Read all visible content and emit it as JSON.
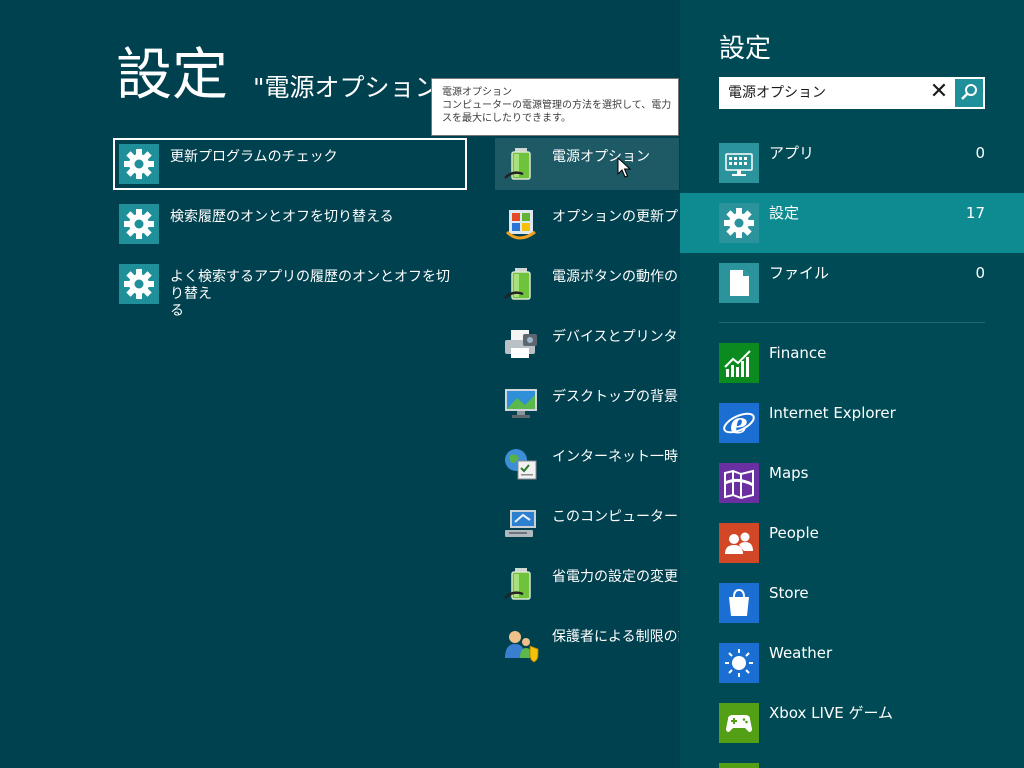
{
  "main": {
    "title": "設定",
    "query": "\"電源オプション\"",
    "left_results": [
      {
        "label": "更新プログラムのチェック",
        "icon": "gear-icon"
      },
      {
        "label": "検索履歴のオンとオフを切り替える",
        "icon": "gear-icon"
      },
      {
        "label": "よく検索するアプリの履歴のオンとオフを切り替え\nる",
        "icon": "gear-icon"
      }
    ],
    "right_results": [
      {
        "label": "電源オプション",
        "icon": "battery-icon"
      },
      {
        "label": "オプションの更新プログ",
        "icon": "windows-update-icon"
      },
      {
        "label": "電源ボタンの動作の変",
        "icon": "battery-icon"
      },
      {
        "label": "デバイスとプリンターの表",
        "icon": "printer-icon"
      },
      {
        "label": "デスクトップの背景の変",
        "icon": "desktop-background-icon"
      },
      {
        "label": "インターネット一時ファ",
        "icon": "internet-options-icon"
      },
      {
        "label": "このコンピューターへのリ",
        "icon": "remote-computer-icon"
      },
      {
        "label": "省電力の設定の変更",
        "icon": "battery-icon"
      },
      {
        "label": "保護者による制限の設",
        "icon": "parental-controls-icon"
      }
    ],
    "tooltip": {
      "title": "電源オプション",
      "line1": "コンピューターの電源管理の方法を選択して、電力",
      "line2": "スを最大にしたりできます。"
    }
  },
  "pane": {
    "title": "設定",
    "search": {
      "value": "電源オプション",
      "clear_icon": "close-icon",
      "search_icon": "search-icon"
    },
    "categories": [
      {
        "label": "アプリ",
        "count": "0",
        "icon": "keyboard-icon"
      },
      {
        "label": "設定",
        "count": "17",
        "icon": "gear-icon"
      },
      {
        "label": "ファイル",
        "count": "0",
        "icon": "file-icon"
      }
    ],
    "apps": [
      {
        "label": "Finance",
        "icon": "finance-icon",
        "color": "#0b8a1f"
      },
      {
        "label": "Internet Explorer",
        "icon": "internet-explorer-icon",
        "color": "#1b6fd2"
      },
      {
        "label": "Maps",
        "icon": "maps-icon",
        "color": "#6a2fa0"
      },
      {
        "label": "People",
        "icon": "people-icon",
        "color": "#d24726"
      },
      {
        "label": "Store",
        "icon": "store-icon",
        "color": "#1b6fd2"
      },
      {
        "label": "Weather",
        "icon": "weather-icon",
        "color": "#1b6fd2"
      },
      {
        "label": "Xbox LIVE ゲーム",
        "icon": "xbox-icon",
        "color": "#53a016"
      }
    ]
  }
}
